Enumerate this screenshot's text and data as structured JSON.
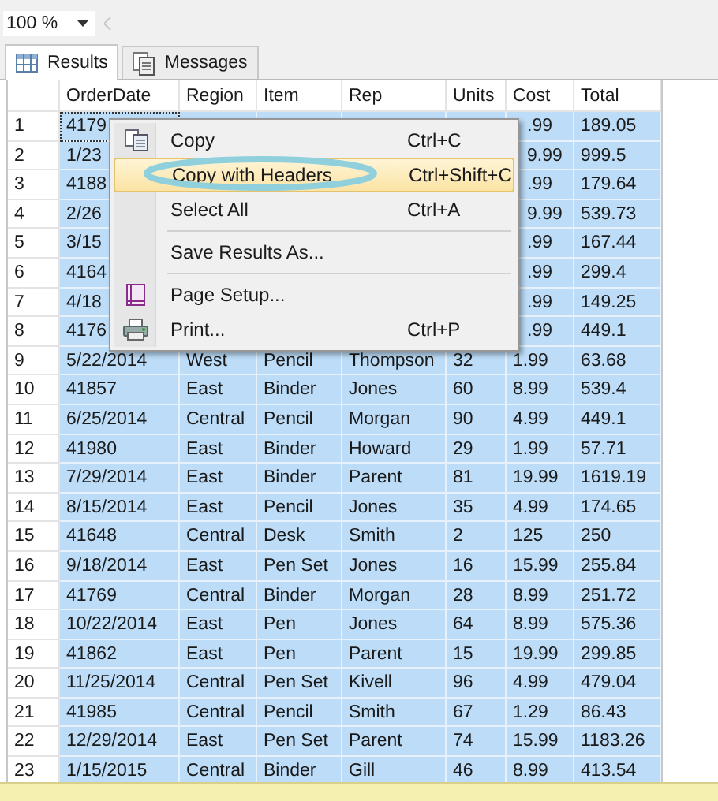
{
  "toolbar": {
    "zoom": "100 %"
  },
  "tabs": [
    {
      "label": "Results",
      "selected": true,
      "kind": "grid"
    },
    {
      "label": "Messages",
      "selected": false,
      "kind": "messages"
    }
  ],
  "table": {
    "columns": [
      "OrderDate",
      "Region",
      "Item",
      "Rep",
      "Units",
      "Cost",
      "Total"
    ],
    "rows": [
      {
        "num": "1",
        "selected": true,
        "focused": true,
        "cells": [
          "4179",
          null,
          null,
          null,
          null,
          ".99",
          "189.05"
        ]
      },
      {
        "num": "2",
        "selected": true,
        "focused": false,
        "cells": [
          "1/23",
          null,
          null,
          null,
          null,
          "9.99",
          "999.5"
        ]
      },
      {
        "num": "3",
        "selected": true,
        "focused": false,
        "cells": [
          "4188",
          null,
          null,
          null,
          null,
          ".99",
          "179.64"
        ]
      },
      {
        "num": "4",
        "selected": true,
        "focused": false,
        "cells": [
          "2/26",
          null,
          null,
          null,
          null,
          "9.99",
          "539.73"
        ]
      },
      {
        "num": "5",
        "selected": true,
        "focused": false,
        "cells": [
          "3/15",
          null,
          null,
          null,
          null,
          ".99",
          "167.44"
        ]
      },
      {
        "num": "6",
        "selected": true,
        "focused": false,
        "cells": [
          "4164",
          null,
          null,
          null,
          null,
          ".99",
          "299.4"
        ]
      },
      {
        "num": "7",
        "selected": true,
        "focused": false,
        "cells": [
          "4/18",
          null,
          null,
          null,
          null,
          ".99",
          "149.25"
        ]
      },
      {
        "num": "8",
        "selected": true,
        "focused": false,
        "cells": [
          "4176",
          null,
          null,
          null,
          null,
          ".99",
          "449.1"
        ]
      },
      {
        "num": "9",
        "selected": true,
        "focused": false,
        "cells": [
          "5/22/2014",
          "West",
          "Pencil",
          "Thompson",
          "32",
          "1.99",
          "63.68"
        ]
      },
      {
        "num": "10",
        "selected": true,
        "focused": false,
        "cells": [
          "41857",
          "East",
          "Binder",
          "Jones",
          "60",
          "8.99",
          "539.4"
        ]
      },
      {
        "num": "11",
        "selected": true,
        "focused": false,
        "cells": [
          "6/25/2014",
          "Central",
          "Pencil",
          "Morgan",
          "90",
          "4.99",
          "449.1"
        ]
      },
      {
        "num": "12",
        "selected": true,
        "focused": false,
        "cells": [
          "41980",
          "East",
          "Binder",
          "Howard",
          "29",
          "1.99",
          "57.71"
        ]
      },
      {
        "num": "13",
        "selected": true,
        "focused": false,
        "cells": [
          "7/29/2014",
          "East",
          "Binder",
          "Parent",
          "81",
          "19.99",
          "1619.19"
        ]
      },
      {
        "num": "14",
        "selected": true,
        "focused": false,
        "cells": [
          "8/15/2014",
          "East",
          "Pencil",
          "Jones",
          "35",
          "4.99",
          "174.65"
        ]
      },
      {
        "num": "15",
        "selected": true,
        "focused": false,
        "cells": [
          "41648",
          "Central",
          "Desk",
          "Smith",
          "2",
          "125",
          "250"
        ]
      },
      {
        "num": "16",
        "selected": true,
        "focused": false,
        "cells": [
          "9/18/2014",
          "East",
          "Pen Set",
          "Jones",
          "16",
          "15.99",
          "255.84"
        ]
      },
      {
        "num": "17",
        "selected": true,
        "focused": false,
        "cells": [
          "41769",
          "Central",
          "Binder",
          "Morgan",
          "28",
          "8.99",
          "251.72"
        ]
      },
      {
        "num": "18",
        "selected": true,
        "focused": false,
        "cells": [
          "10/22/2014",
          "East",
          "Pen",
          "Jones",
          "64",
          "8.99",
          "575.36"
        ]
      },
      {
        "num": "19",
        "selected": true,
        "focused": false,
        "cells": [
          "41862",
          "East",
          "Pen",
          "Parent",
          "15",
          "19.99",
          "299.85"
        ]
      },
      {
        "num": "20",
        "selected": true,
        "focused": false,
        "cells": [
          "11/25/2014",
          "Central",
          "Pen Set",
          "Kivell",
          "96",
          "4.99",
          "479.04"
        ]
      },
      {
        "num": "21",
        "selected": true,
        "focused": false,
        "cells": [
          "41985",
          "Central",
          "Pencil",
          "Smith",
          "67",
          "1.29",
          "86.43"
        ]
      },
      {
        "num": "22",
        "selected": true,
        "focused": false,
        "cells": [
          "12/29/2014",
          "East",
          "Pen Set",
          "Parent",
          "74",
          "15.99",
          "1183.26"
        ]
      },
      {
        "num": "23",
        "selected": true,
        "focused": false,
        "cells": [
          "1/15/2015",
          "Central",
          "Binder",
          "Gill",
          "46",
          "8.99",
          "413.54"
        ]
      }
    ]
  },
  "context_menu": {
    "items": [
      {
        "kind": "item",
        "label": "Copy",
        "shortcut": "Ctrl+C",
        "selected": false
      },
      {
        "kind": "item",
        "label": "Copy with Headers",
        "shortcut": "Ctrl+Shift+C",
        "selected": true
      },
      {
        "kind": "item",
        "label": "Select All",
        "shortcut": "Ctrl+A",
        "selected": false
      },
      {
        "kind": "separator"
      },
      {
        "kind": "item",
        "label": "Save Results As...",
        "selected": false
      },
      {
        "kind": "separator"
      },
      {
        "kind": "item",
        "label": "Page Setup...",
        "selected": false
      },
      {
        "kind": "item",
        "label": "Print...",
        "shortcut": "Ctrl+P",
        "selected": false
      }
    ]
  }
}
